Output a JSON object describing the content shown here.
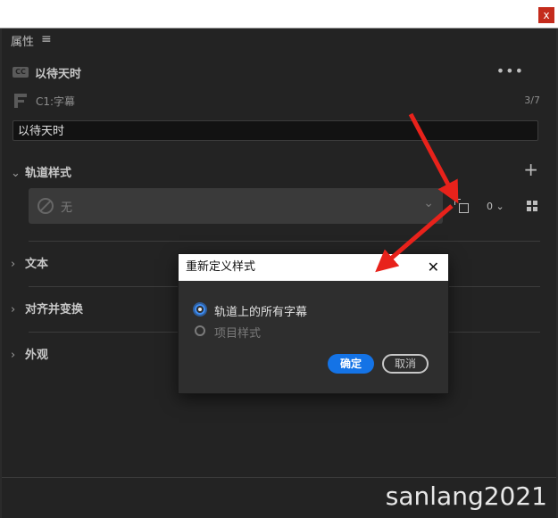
{
  "window": {
    "close_glyph": "x"
  },
  "panel": {
    "header": "属性",
    "menu_icon": "hamburger-icon",
    "clip_badge": "CC",
    "clip_title": "以待天时",
    "more_icon": "more-horizontal-icon",
    "track_name": "C1:字幕",
    "counter": "3/7",
    "text_value": "以待天时"
  },
  "sections": {
    "track_style": {
      "label": "轨道样式",
      "dropdown_value": "无",
      "zero_value": "0"
    },
    "text": {
      "label": "文本"
    },
    "align": {
      "label": "对齐并变换"
    },
    "appearance": {
      "label": "外观"
    }
  },
  "dialog": {
    "title": "重新定义样式",
    "options": [
      {
        "label": "轨道上的所有字幕",
        "selected": true
      },
      {
        "label": "项目样式",
        "selected": false
      }
    ],
    "ok_label": "确定",
    "cancel_label": "取消"
  },
  "watermark": "sanlang2021",
  "colors": {
    "accent": "#1473e6",
    "arrow": "#e8221b",
    "panel_bg": "#232323"
  }
}
